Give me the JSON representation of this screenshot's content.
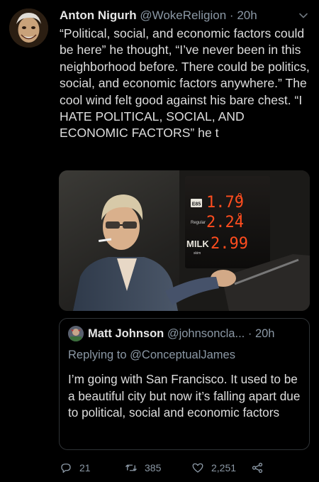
{
  "author": {
    "name": "Anton Nigurh",
    "handle": "@WokeReligion",
    "separator": "·",
    "time": "20h"
  },
  "tweet_text": "“Political, social, and economic factors could be here” he thought, “I’ve never been in this neighborhood before. There could be politics, social, and economic factors anywhere.” The cool wind felt good against his bare chest. “I HATE POLITICAL, SOCIAL, AND ECONOMIC FACTORS” he t",
  "media": {
    "gas_sign": {
      "badge": "E85",
      "price1": "1.79",
      "sup1": "9",
      "label2": "Regular",
      "price2": "2.24",
      "sup2": "9",
      "label3": "MILK",
      "sublabel3": "skim",
      "price3": "2.99"
    }
  },
  "quote": {
    "name": "Matt Johnson",
    "handle": "@johnsoncla...",
    "separator": "·",
    "time": "20h",
    "reply_prefix": "Replying to",
    "reply_to": "@ConceptualJames",
    "text": "I’m going with San Francisco.  It used to be a beautiful city but now it’s falling apart due to political, social and economic factors"
  },
  "actions": {
    "reply_count": "21",
    "retweet_count": "385",
    "like_count": "2,251"
  },
  "icons": {
    "reply": "comment-icon",
    "retweet": "retweet-icon",
    "like": "heart-icon",
    "share": "share-icon",
    "menu": "chevron-down-icon"
  },
  "colors": {
    "background": "#000000",
    "text": "#dedede",
    "muted": "#8b98a5",
    "border": "#2f3336",
    "price_led": "#ff4d1f"
  }
}
